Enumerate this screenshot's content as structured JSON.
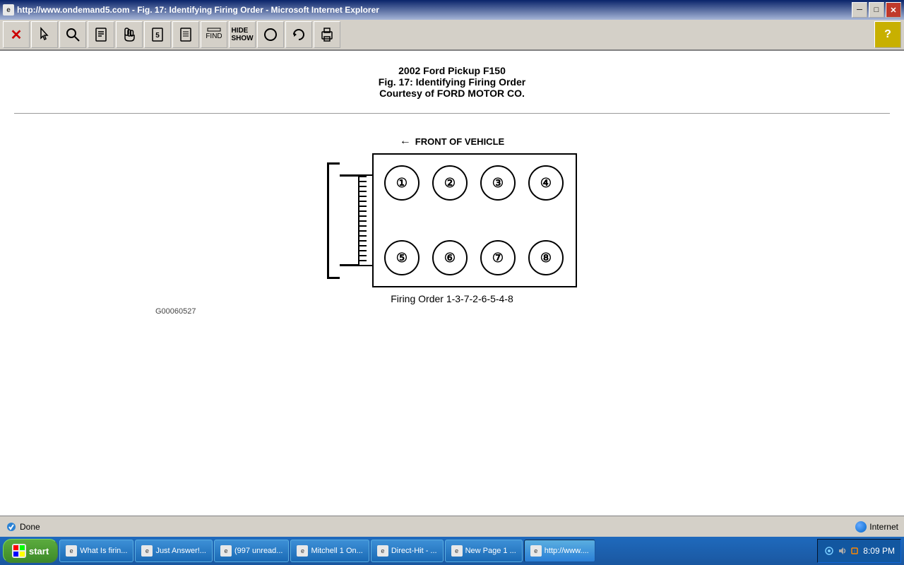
{
  "window": {
    "title": "http://www.ondemand5.com - Fig. 17: Identifying Firing Order - Microsoft Internet Explorer",
    "icon_label": "IE"
  },
  "toolbar": {
    "buttons": [
      {
        "id": "close",
        "label": "✕",
        "type": "red-x"
      },
      {
        "id": "pointer",
        "label": "🔍"
      },
      {
        "id": "magnify",
        "label": "🔎"
      },
      {
        "id": "doc",
        "label": "📄"
      },
      {
        "id": "hand",
        "label": "✋"
      },
      {
        "id": "doc2",
        "label": "📋"
      },
      {
        "id": "doc3",
        "label": "📋"
      },
      {
        "id": "find",
        "label": "🔍"
      },
      {
        "id": "hideshow",
        "label": "👁"
      },
      {
        "id": "circle",
        "label": "⭕"
      },
      {
        "id": "refresh",
        "label": "🔄"
      },
      {
        "id": "print",
        "label": "🖨"
      }
    ],
    "help_label": "?"
  },
  "page": {
    "line1": "2002 Ford Pickup F150",
    "line2": "Fig. 17: Identifying Firing Order",
    "line3": "Courtesy of FORD MOTOR CO.",
    "front_label": "FRONT OF VEHICLE",
    "cylinders_top": [
      "①",
      "②",
      "③",
      "④"
    ],
    "cylinders_bottom": [
      "⑤",
      "⑥",
      "⑦",
      "⑧"
    ],
    "firing_order": "Firing Order 1-3-7-2-6-5-4-8",
    "diagram_id": "G00060527"
  },
  "status": {
    "done_label": "Done",
    "zone_label": "Internet"
  },
  "taskbar": {
    "start_label": "start",
    "items": [
      {
        "label": "What Is firin...",
        "active": false
      },
      {
        "label": "Just Answer!...",
        "active": false
      },
      {
        "label": "(997 unread...",
        "active": false
      },
      {
        "label": "Mitchell 1 On...",
        "active": false
      },
      {
        "label": "Direct-Hit - ...",
        "active": false
      },
      {
        "label": "New Page 1 ...",
        "active": false
      },
      {
        "label": "http://www....",
        "active": true
      }
    ],
    "clock": "8:09 PM"
  }
}
